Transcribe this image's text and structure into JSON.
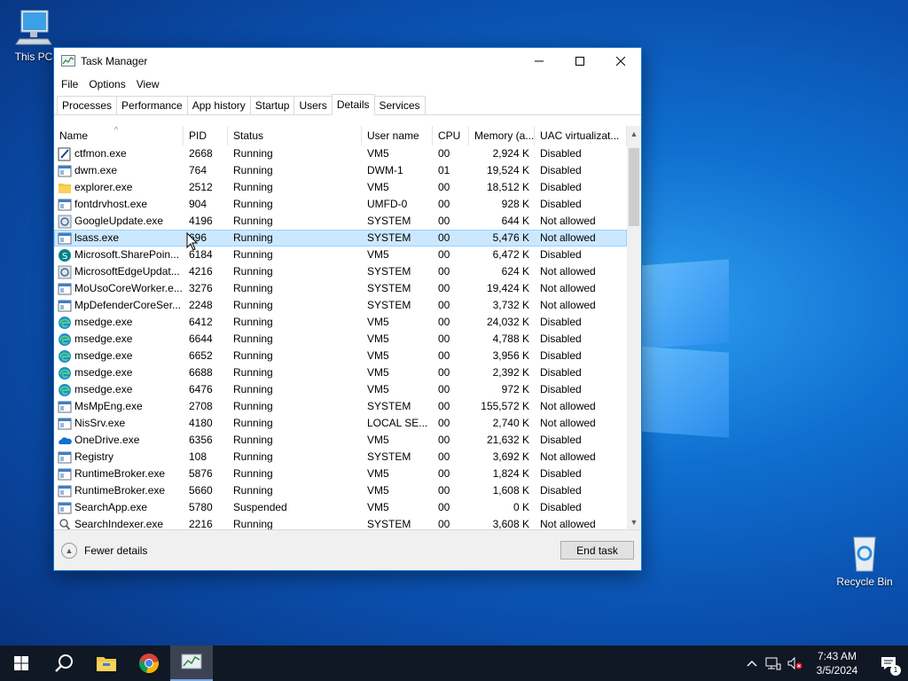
{
  "desktop": {
    "this_pc_label": "This PC",
    "recycle_bin_label": "Recycle Bin"
  },
  "window": {
    "title": "Task Manager",
    "menu": [
      "File",
      "Options",
      "View"
    ],
    "tabs": [
      "Processes",
      "Performance",
      "App history",
      "Startup",
      "Users",
      "Details",
      "Services"
    ],
    "active_tab": "Details",
    "columns": [
      "Name",
      "PID",
      "Status",
      "User name",
      "CPU",
      "Memory (a...",
      "UAC virtualizat..."
    ],
    "rows": [
      {
        "name": "ctfmon.exe",
        "pid": "2668",
        "status": "Running",
        "user": "VM5",
        "cpu": "00",
        "mem": "2,924 K",
        "uac": "Disabled",
        "icon": "ctfmon-icon"
      },
      {
        "name": "dwm.exe",
        "pid": "764",
        "status": "Running",
        "user": "DWM-1",
        "cpu": "01",
        "mem": "19,524 K",
        "uac": "Disabled",
        "icon": "app-window-icon"
      },
      {
        "name": "explorer.exe",
        "pid": "2512",
        "status": "Running",
        "user": "VM5",
        "cpu": "00",
        "mem": "18,512 K",
        "uac": "Disabled",
        "icon": "folder-icon"
      },
      {
        "name": "fontdrvhost.exe",
        "pid": "904",
        "status": "Running",
        "user": "UMFD-0",
        "cpu": "00",
        "mem": "928 K",
        "uac": "Disabled",
        "icon": "app-window-icon"
      },
      {
        "name": "GoogleUpdate.exe",
        "pid": "4196",
        "status": "Running",
        "user": "SYSTEM",
        "cpu": "00",
        "mem": "644 K",
        "uac": "Not allowed",
        "icon": "installer-icon"
      },
      {
        "name": "lsass.exe",
        "pid": "696",
        "status": "Running",
        "user": "SYSTEM",
        "cpu": "00",
        "mem": "5,476 K",
        "uac": "Not allowed",
        "icon": "app-window-icon",
        "selected": true
      },
      {
        "name": "Microsoft.SharePoin...",
        "pid": "6184",
        "status": "Running",
        "user": "VM5",
        "cpu": "00",
        "mem": "6,472 K",
        "uac": "Disabled",
        "icon": "sharepoint-icon"
      },
      {
        "name": "MicrosoftEdgeUpdat...",
        "pid": "4216",
        "status": "Running",
        "user": "SYSTEM",
        "cpu": "00",
        "mem": "624 K",
        "uac": "Not allowed",
        "icon": "installer-icon"
      },
      {
        "name": "MoUsoCoreWorker.e...",
        "pid": "3276",
        "status": "Running",
        "user": "SYSTEM",
        "cpu": "00",
        "mem": "19,424 K",
        "uac": "Not allowed",
        "icon": "app-window-icon"
      },
      {
        "name": "MpDefenderCoreSer...",
        "pid": "2248",
        "status": "Running",
        "user": "SYSTEM",
        "cpu": "00",
        "mem": "3,732 K",
        "uac": "Not allowed",
        "icon": "app-window-icon"
      },
      {
        "name": "msedge.exe",
        "pid": "6412",
        "status": "Running",
        "user": "VM5",
        "cpu": "00",
        "mem": "24,032 K",
        "uac": "Disabled",
        "icon": "edge-icon"
      },
      {
        "name": "msedge.exe",
        "pid": "6644",
        "status": "Running",
        "user": "VM5",
        "cpu": "00",
        "mem": "4,788 K",
        "uac": "Disabled",
        "icon": "edge-icon"
      },
      {
        "name": "msedge.exe",
        "pid": "6652",
        "status": "Running",
        "user": "VM5",
        "cpu": "00",
        "mem": "3,956 K",
        "uac": "Disabled",
        "icon": "edge-icon"
      },
      {
        "name": "msedge.exe",
        "pid": "6688",
        "status": "Running",
        "user": "VM5",
        "cpu": "00",
        "mem": "2,392 K",
        "uac": "Disabled",
        "icon": "edge-icon"
      },
      {
        "name": "msedge.exe",
        "pid": "6476",
        "status": "Running",
        "user": "VM5",
        "cpu": "00",
        "mem": "972 K",
        "uac": "Disabled",
        "icon": "edge-icon"
      },
      {
        "name": "MsMpEng.exe",
        "pid": "2708",
        "status": "Running",
        "user": "SYSTEM",
        "cpu": "00",
        "mem": "155,572 K",
        "uac": "Not allowed",
        "icon": "app-window-icon"
      },
      {
        "name": "NisSrv.exe",
        "pid": "4180",
        "status": "Running",
        "user": "LOCAL SE...",
        "cpu": "00",
        "mem": "2,740 K",
        "uac": "Not allowed",
        "icon": "app-window-icon"
      },
      {
        "name": "OneDrive.exe",
        "pid": "6356",
        "status": "Running",
        "user": "VM5",
        "cpu": "00",
        "mem": "21,632 K",
        "uac": "Disabled",
        "icon": "onedrive-icon"
      },
      {
        "name": "Registry",
        "pid": "108",
        "status": "Running",
        "user": "SYSTEM",
        "cpu": "00",
        "mem": "3,692 K",
        "uac": "Not allowed",
        "icon": "app-window-icon"
      },
      {
        "name": "RuntimeBroker.exe",
        "pid": "5876",
        "status": "Running",
        "user": "VM5",
        "cpu": "00",
        "mem": "1,824 K",
        "uac": "Disabled",
        "icon": "app-window-icon"
      },
      {
        "name": "RuntimeBroker.exe",
        "pid": "5660",
        "status": "Running",
        "user": "VM5",
        "cpu": "00",
        "mem": "1,608 K",
        "uac": "Disabled",
        "icon": "app-window-icon"
      },
      {
        "name": "SearchApp.exe",
        "pid": "5780",
        "status": "Suspended",
        "user": "VM5",
        "cpu": "00",
        "mem": "0 K",
        "uac": "Disabled",
        "icon": "app-window-icon"
      },
      {
        "name": "SearchIndexer.exe",
        "pid": "2216",
        "status": "Running",
        "user": "SYSTEM",
        "cpu": "00",
        "mem": "3,608 K",
        "uac": "Not allowed",
        "icon": "search-indexer-icon"
      }
    ],
    "fewer_details_label": "Fewer details",
    "end_task_label": "End task"
  },
  "taskbar": {
    "time": "7:43 AM",
    "date": "3/5/2024",
    "notification_count": "1",
    "apps": [
      "start-icon",
      "search-icon",
      "file-explorer-icon",
      "chrome-icon",
      "task-manager-icon"
    ]
  },
  "colors": {
    "selection": "#cce8ff",
    "accent": "#1778d6",
    "taskbar": "#101725"
  }
}
